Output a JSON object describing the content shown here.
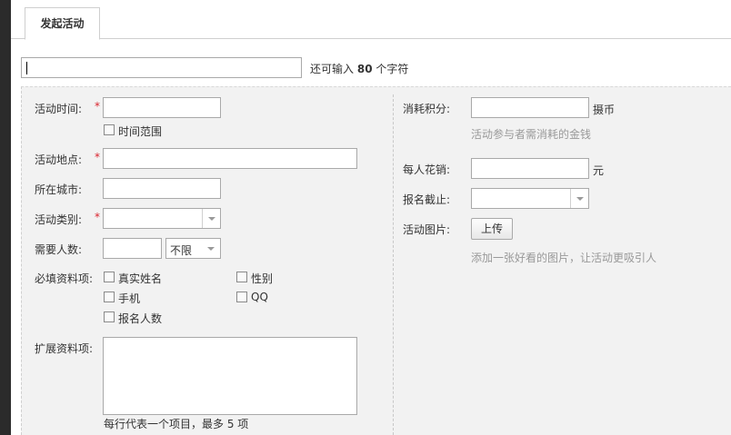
{
  "tab": {
    "label": "发起活动"
  },
  "title_field": {
    "value": "",
    "hint_prefix": "还可输入",
    "hint_count": "80",
    "hint_suffix": "个字符"
  },
  "left": {
    "time_label": "活动时间:",
    "time_range_label": "时间范围",
    "place_label": "活动地点:",
    "city_label": "所在城市:",
    "category_label": "活动类别:",
    "people_label": "需要人数:",
    "people_select": "不限",
    "required_label": "必填资料项:",
    "required_options": [
      "真实姓名",
      "性别",
      "手机",
      "QQ",
      "报名人数"
    ],
    "extra_label": "扩展资料项:",
    "extra_hint": "每行代表一个项目，最多 5 项",
    "required_mark": "*"
  },
  "right": {
    "points_label": "消耗积分:",
    "points_unit": "摄币",
    "points_hint": "活动参与者需消耗的金钱",
    "cost_label": "每人花销:",
    "cost_unit": "元",
    "deadline_label": "报名截止:",
    "image_label": "活动图片:",
    "upload_label": "上传",
    "image_hint": "添加一张好看的图片，让活动更吸引人"
  }
}
